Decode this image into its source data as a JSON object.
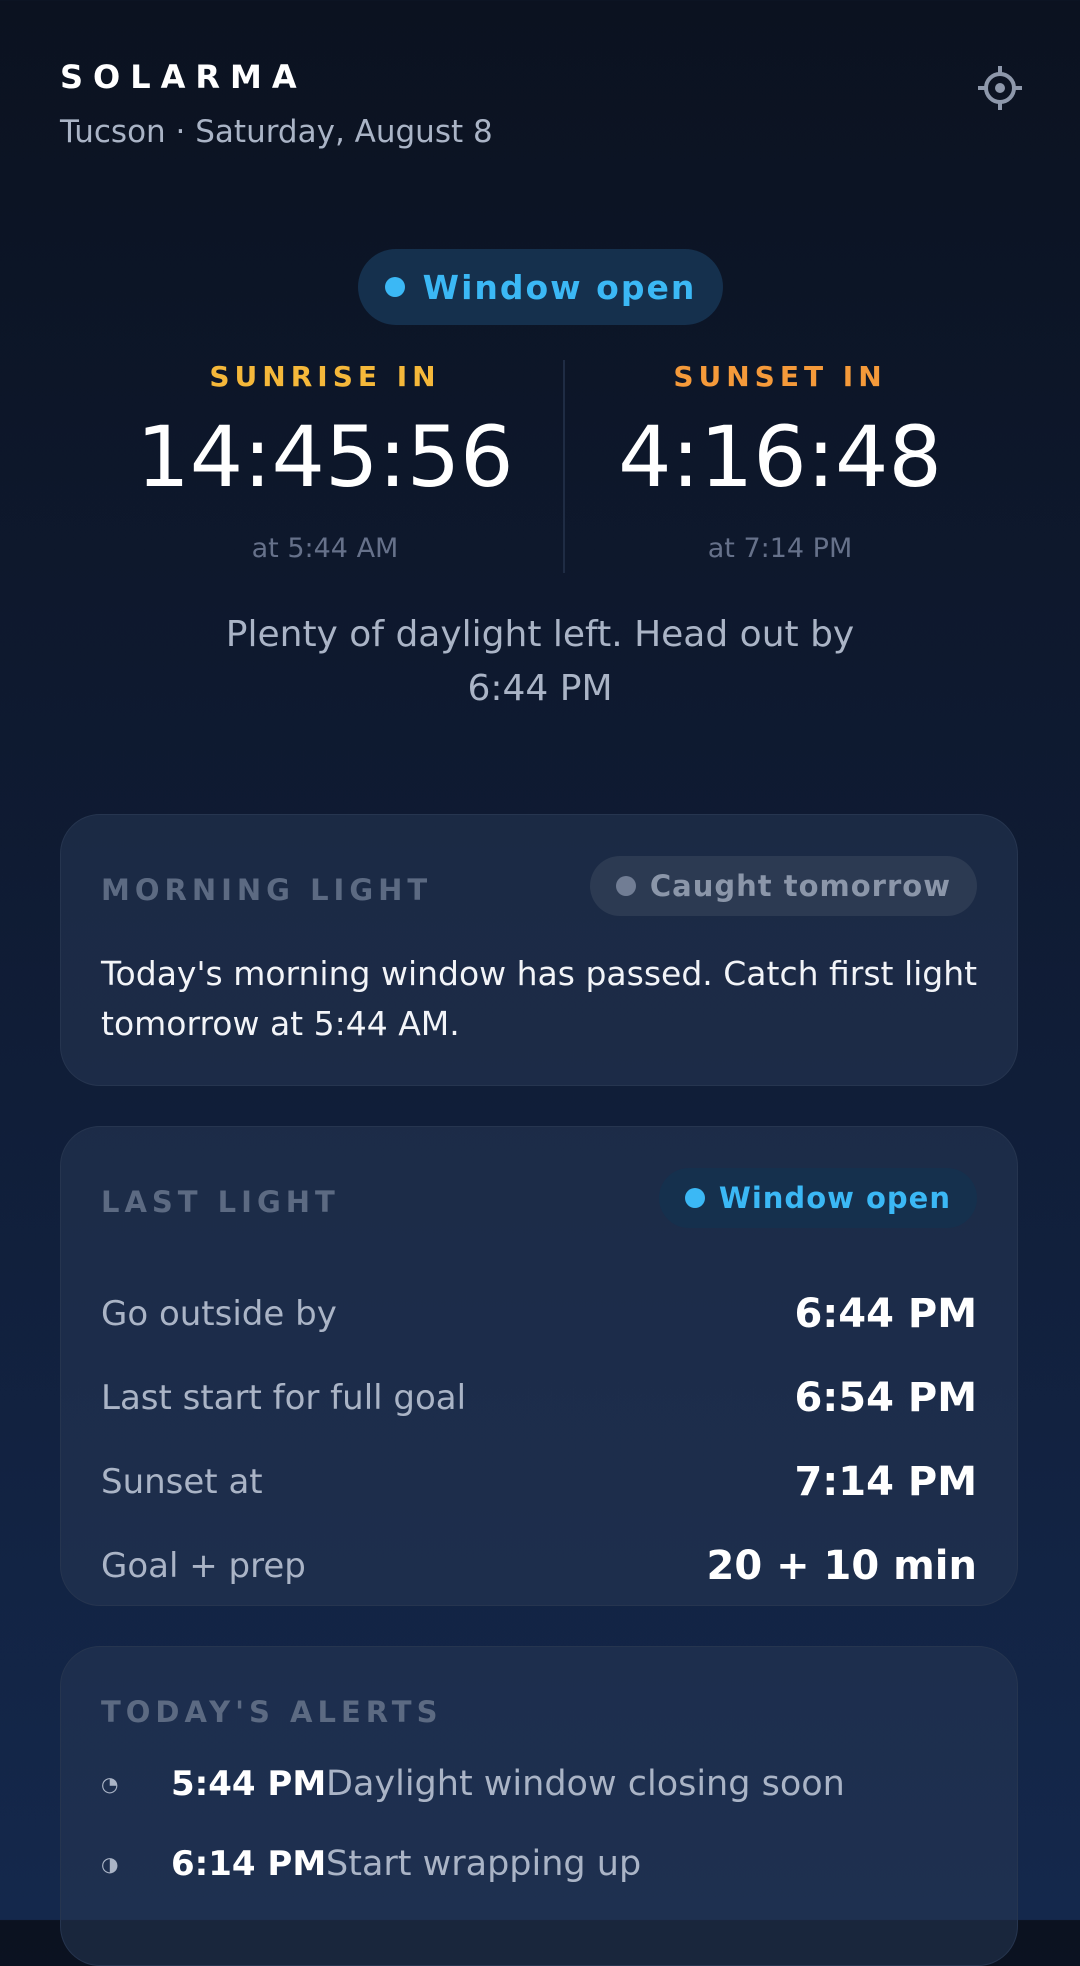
{
  "header": {
    "brand": "SOLARMA",
    "subtitle": "Tucson · Saturday, August 8"
  },
  "status": {
    "label": "Window open"
  },
  "sunrise": {
    "kicker": "SUNRISE IN",
    "countdown": "14:45:56",
    "at": "at 5:44 AM"
  },
  "sunset": {
    "kicker": "SUNSET IN",
    "countdown": "4:16:48",
    "at": "at 7:14 PM"
  },
  "message": "Plenty of daylight left. Head out by 6:44 PM",
  "morning_card": {
    "title": "MORNING LIGHT",
    "badge": "Caught tomorrow",
    "body": "Today's morning window has passed. Catch first light tomorrow at 5:44 AM."
  },
  "last_light_card": {
    "title": "LAST LIGHT",
    "badge": "Window open",
    "rows": [
      {
        "label": "Go outside by",
        "value": "6:44 PM"
      },
      {
        "label": "Last start for full goal",
        "value": "6:54 PM"
      },
      {
        "label": "Sunset at",
        "value": "7:14 PM"
      },
      {
        "label": "Goal + prep",
        "value": "20 + 10 min"
      }
    ]
  },
  "alerts_card": {
    "title": "TODAY'S ALERTS",
    "items": [
      {
        "icon": "clock-quarter-icon",
        "glyph": "◔",
        "time": "5:44 PM",
        "text": "Daylight window closing soon"
      },
      {
        "icon": "half-moon-icon",
        "glyph": "◑",
        "time": "6:14 PM",
        "text": "Start wrapping up"
      }
    ]
  },
  "colors": {
    "accent_blue": "#3bb8f5",
    "sunrise_yellow": "#f5b83a",
    "sunset_orange": "#f59a3a"
  }
}
